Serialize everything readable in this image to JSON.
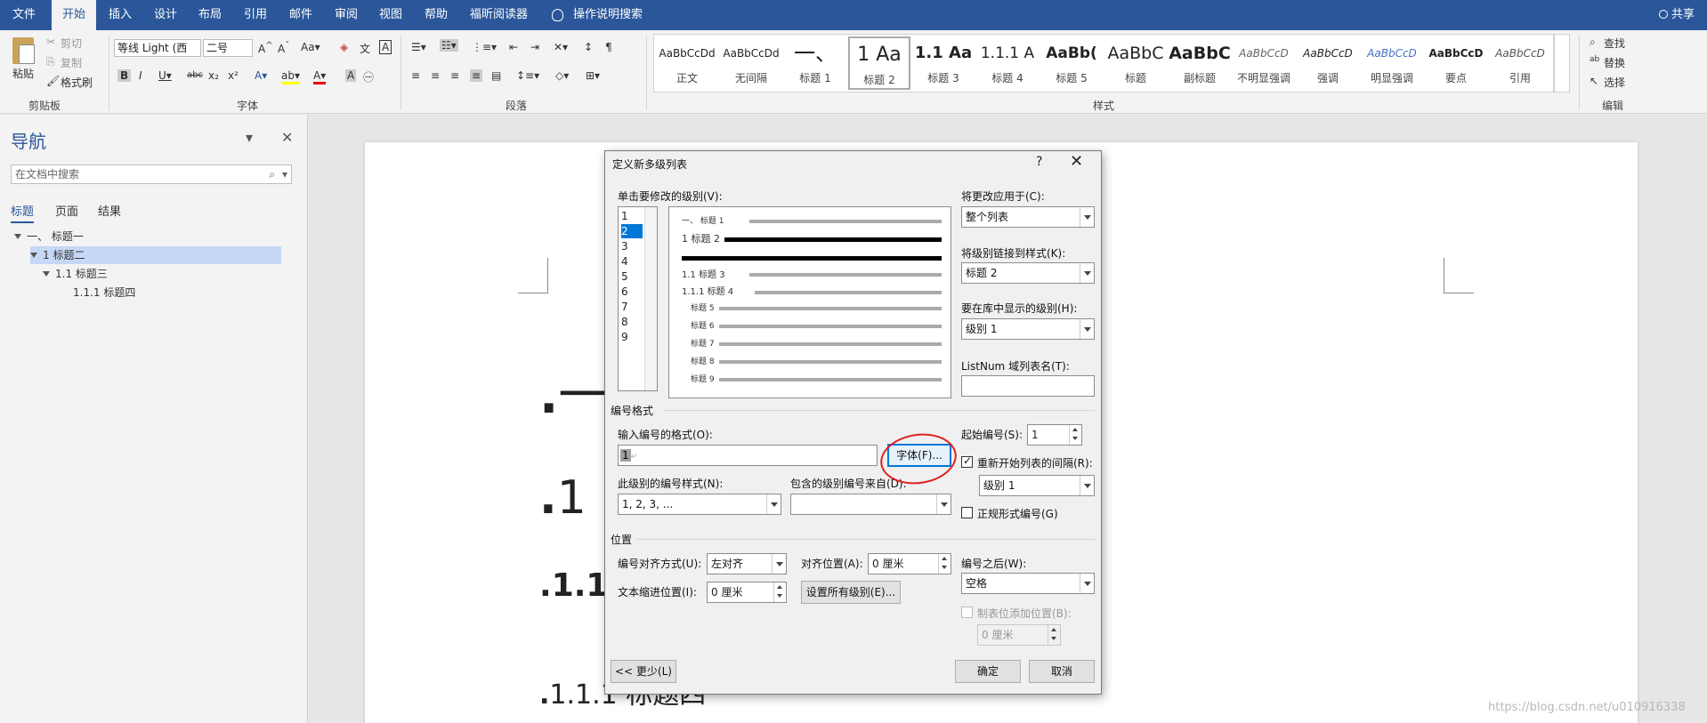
{
  "tabs": [
    "文件",
    "开始",
    "插入",
    "设计",
    "布局",
    "引用",
    "邮件",
    "审阅",
    "视图",
    "帮助",
    "福昕阅读器"
  ],
  "tab_search": "操作说明搜索",
  "share": "共享",
  "ribbon": {
    "clipboard": {
      "paste": "粘贴",
      "cut": "剪切",
      "copy": "复制",
      "format_painter": "格式刷",
      "label": "剪贴板"
    },
    "font": {
      "font_name": "等线 Light (西",
      "font_size": "二号",
      "label": "字体"
    },
    "paragraph": {
      "label": "段落"
    },
    "styles": {
      "label": "样式",
      "items": [
        {
          "sample": "AaBbCcDd",
          "name": "正文"
        },
        {
          "sample": "AaBbCcDd",
          "name": "无间隔"
        },
        {
          "sample": "一、",
          "name": "标题 1"
        },
        {
          "sample": "1 Aa",
          "name": "标题 2"
        },
        {
          "sample": "1.1 Aa",
          "name": "标题 3"
        },
        {
          "sample": "1.1.1 A",
          "name": "标题 4"
        },
        {
          "sample": "AaBb(",
          "name": "标题 5"
        },
        {
          "sample": "AaBbC",
          "name": "标题"
        },
        {
          "sample": "AaBbC",
          "name": "副标题"
        },
        {
          "sample": "AaBbCcD",
          "name": "不明显强调"
        },
        {
          "sample": "AaBbCcD",
          "name": "强调"
        },
        {
          "sample": "AaBbCcD",
          "name": "明显强调"
        },
        {
          "sample": "AaBbCcD",
          "name": "要点"
        },
        {
          "sample": "AaBbCcD",
          "name": "引用"
        }
      ]
    },
    "editing": {
      "find": "查找",
      "replace": "替换",
      "select": "选择",
      "label": "编辑"
    }
  },
  "nav": {
    "title": "导航",
    "search_placeholder": "在文档中搜索",
    "tabs": [
      "标题",
      "页面",
      "结果"
    ],
    "tree": [
      "一、 标题一",
      "1 标题二",
      "1.1 标题三",
      "1.1.1 标题四"
    ]
  },
  "document": {
    "lines": [
      "一",
      "1",
      "1.1",
      "1.1.1 标题四"
    ]
  },
  "dialog": {
    "title": "定义新多级列表",
    "help": "?",
    "close": "✕",
    "level_label": "单击要修改的级别(V):",
    "levels": [
      "1",
      "2",
      "3",
      "4",
      "5",
      "6",
      "7",
      "8",
      "9"
    ],
    "preview_labels": [
      "一、 标题 1",
      "1 标题 2",
      "1.1 标题 3",
      "1.1.1 标题 4",
      "标题 5",
      "标题 6",
      "标题 7",
      "标题 8",
      "标题 9"
    ],
    "apply_label": "将更改应用于(C):",
    "apply_value": "整个列表",
    "link_label": "将级别链接到样式(K):",
    "link_value": "标题 2",
    "gallery_label": "要在库中显示的级别(H):",
    "gallery_value": "级别 1",
    "listnum_label": "ListNum 域列表名(T):",
    "listnum_value": "",
    "number_format_section": "编号格式",
    "number_format_label": "输入编号的格式(O):",
    "number_format_value": "1",
    "font_button": "字体(F)...",
    "number_style_label": "此级别的编号样式(N):",
    "number_style_value": "1, 2, 3, ...",
    "include_level_label": "包含的级别编号来自(D):",
    "include_level_value": "",
    "start_at_label": "起始编号(S):",
    "start_at_value": "1",
    "restart_label": "重新开始列表的间隔(R):",
    "restart_value": "级别 1",
    "legal_label": "正规形式编号(G)",
    "position_section": "位置",
    "alignment_label": "编号对齐方式(U):",
    "alignment_value": "左对齐",
    "aligned_at_label": "对齐位置(A):",
    "aligned_at_value": "0 厘米",
    "indent_label": "文本缩进位置(I):",
    "indent_value": "0 厘米",
    "set_all_button": "设置所有级别(E)...",
    "follow_label": "编号之后(W):",
    "follow_value": "空格",
    "tab_stop_label": "制表位添加位置(B):",
    "tab_stop_value": "0 厘米",
    "less_button": "<< 更少(L)",
    "ok_button": "确定",
    "cancel_button": "取消"
  },
  "watermark": "https://blog.csdn.net/u010916338",
  "colors": {
    "accent": "#2b579a",
    "selection": "#0078d7",
    "annotation": "#e02020"
  }
}
